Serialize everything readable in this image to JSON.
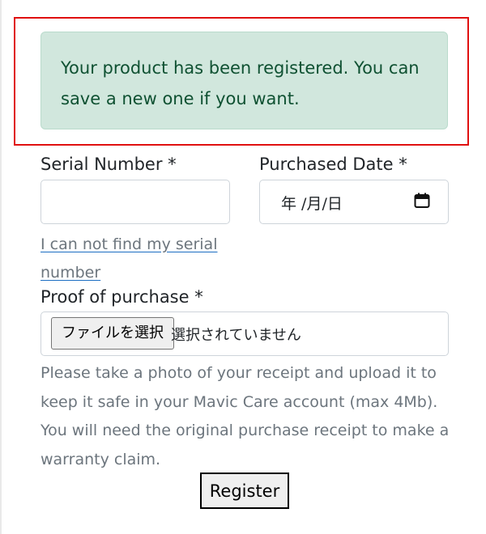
{
  "alert": {
    "message": "Your product has been registered. You can save a new one if you want."
  },
  "form": {
    "serial_label": "Serial Number *",
    "serial_value": "",
    "date_label": "Purchased Date *",
    "date_placeholder": "年 /月/日",
    "help_link": "I can not find my serial number",
    "proof_label": "Proof of purchase *",
    "file_button": "ファイルを選択",
    "file_status": "選択されていません",
    "help_text": "Please take a photo of your receipt and upload it to keep it safe in your Mavic Care account (max 4Mb). You will need the original purchase receipt to make a warranty claim.",
    "submit_label": "Register"
  },
  "colors": {
    "alert_bg": "#d1e7dd",
    "alert_text": "#0f5132",
    "highlight_border": "#e01010",
    "link_underline": "#1b6ec2"
  },
  "icons": {
    "date_picker": "calendar-icon"
  }
}
